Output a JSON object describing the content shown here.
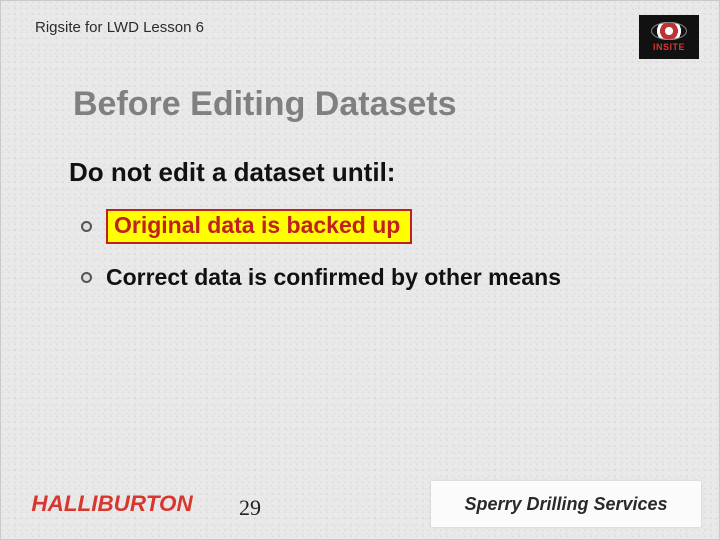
{
  "header": {
    "lesson_label": "Rigsite for LWD Lesson 6",
    "top_logo_label": "INSITE"
  },
  "title": "Before Editing Datasets",
  "subtitle": "Do not edit a dataset until:",
  "bullets": [
    {
      "text": "Original data is backed up",
      "highlight": true
    },
    {
      "text": "Correct data is confirmed by other means",
      "highlight": false
    }
  ],
  "footer": {
    "page_number": "29",
    "left_brand": "HALLIBURTON",
    "right_brand": "Sperry Drilling Services"
  }
}
